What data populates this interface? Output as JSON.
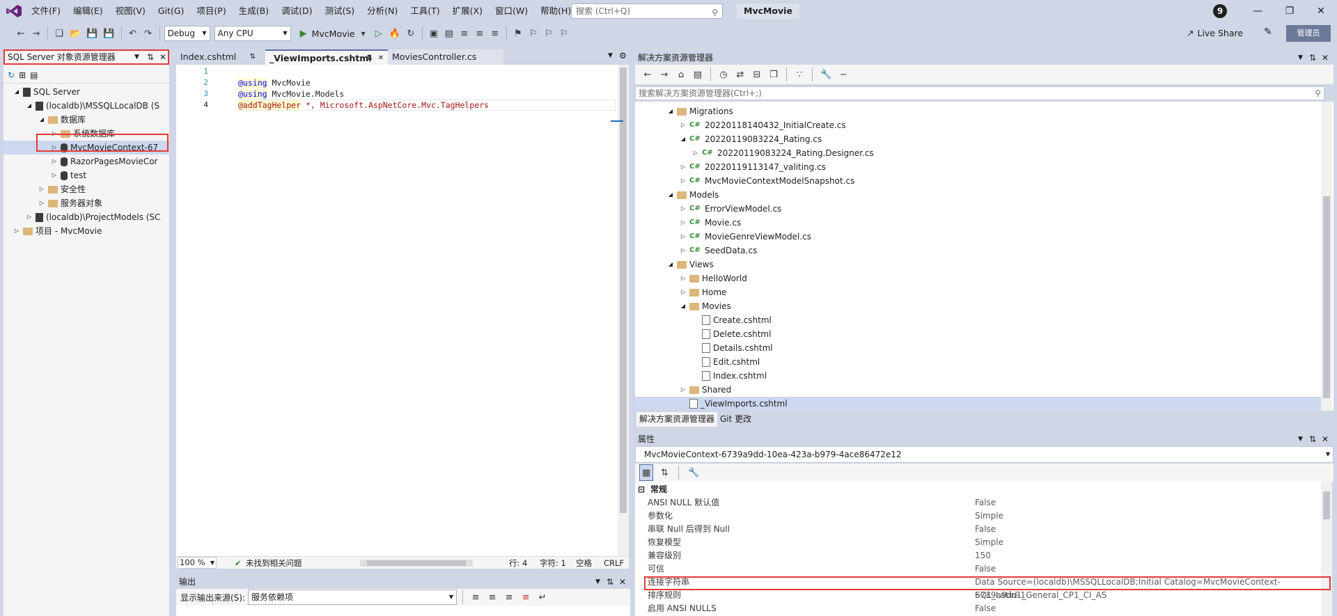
{
  "menubar": {
    "items": [
      "文件(F)",
      "编辑(E)",
      "视图(V)",
      "Git(G)",
      "项目(P)",
      "生成(B)",
      "调试(D)",
      "测试(S)",
      "分析(N)",
      "工具(T)",
      "扩展(X)",
      "窗口(W)",
      "帮助(H)"
    ],
    "search_placeholder": "搜索 (Ctrl+Q)",
    "app_title": "MvcMovie",
    "notification_count": "9"
  },
  "toolbar": {
    "config": "Debug",
    "platform": "Any CPU",
    "run_target": "MvcMovie",
    "live_share": "Live Share",
    "admin": "管理员"
  },
  "sql_explorer": {
    "title": "SQL Server 对象资源管理器",
    "nodes": [
      {
        "label": "SQL Server",
        "level": 1,
        "icon": "server-icon",
        "expand": "open"
      },
      {
        "label": "(localdb)\\MSSQLLocalDB (S",
        "level": 2,
        "icon": "server-icon",
        "expand": "open"
      },
      {
        "label": "数据库",
        "level": 3,
        "icon": "folder-icon",
        "expand": "open"
      },
      {
        "label": "系统数据库",
        "level": 4,
        "icon": "folder-icon",
        "expand": "closed"
      },
      {
        "label": "MvcMovieContext-67",
        "level": 4,
        "icon": "database-icon",
        "expand": "closed",
        "selected": true
      },
      {
        "label": "RazorPagesMovieCor",
        "level": 4,
        "icon": "database-icon",
        "expand": "closed"
      },
      {
        "label": "test",
        "level": 4,
        "icon": "database-icon",
        "expand": "closed"
      },
      {
        "label": "安全性",
        "level": 3,
        "icon": "folder-icon",
        "expand": "closed"
      },
      {
        "label": "服务器对象",
        "level": 3,
        "icon": "folder-icon",
        "expand": "closed"
      },
      {
        "label": "(localdb)\\ProjectModels (SC",
        "level": 2,
        "icon": "server-icon",
        "expand": "closed"
      },
      {
        "label": "项目 - MvcMovie",
        "level": 1,
        "icon": "folder-icon",
        "expand": "closed"
      }
    ]
  },
  "editor": {
    "tabs": [
      "Index.cshtml",
      "_ViewImports.cshtml",
      "MoviesController.cs"
    ],
    "active_tab": 1,
    "line_numbers": [
      "1",
      "2",
      "3",
      "4"
    ],
    "lines": [
      {
        "kw": "@using",
        "rest": " MvcMovie",
        "dir": false
      },
      {
        "kw": "@using",
        "rest": " MvcMovie.Models",
        "dir": false
      },
      {
        "kw": "@addTagHelper",
        "rest": " *, Microsoft.AspNetCore.Mvc.TagHelpers",
        "dir": true
      },
      {
        "kw": "",
        "rest": "",
        "dir": false
      }
    ],
    "status": {
      "zoom": "100 %",
      "issues": "未找到相关问题",
      "line": "行: 4",
      "char": "字符: 1",
      "space": "空格",
      "eol": "CRLF"
    }
  },
  "output": {
    "title": "输出",
    "source_label": "显示输出来源(S):",
    "source_value": "服务依赖项"
  },
  "solution_explorer": {
    "title": "解决方案资源管理器",
    "search_placeholder": "搜索解决方案资源管理器(Ctrl+;)",
    "nodes": [
      {
        "label": "Migrations",
        "level": 1,
        "icon": "folder-icon",
        "expand": "open"
      },
      {
        "label": "20220118140432_InitialCreate.cs",
        "level": 2,
        "icon": "csharp-icon",
        "expand": "closed"
      },
      {
        "label": "20220119083224_Rating.cs",
        "level": 2,
        "icon": "csharp-icon",
        "expand": "open"
      },
      {
        "label": "20220119083224_Rating.Designer.cs",
        "level": 3,
        "icon": "csharp-icon",
        "expand": "closed"
      },
      {
        "label": "20220119113147_valiting.cs",
        "level": 2,
        "icon": "csharp-icon",
        "expand": "closed"
      },
      {
        "label": "MvcMovieContextModelSnapshot.cs",
        "level": 2,
        "icon": "csharp-icon",
        "expand": "closed"
      },
      {
        "label": "Models",
        "level": 1,
        "icon": "folder-icon",
        "expand": "open"
      },
      {
        "label": "ErrorViewModel.cs",
        "level": 2,
        "icon": "csharp-icon",
        "expand": "closed"
      },
      {
        "label": "Movie.cs",
        "level": 2,
        "icon": "csharp-icon",
        "expand": "closed"
      },
      {
        "label": "MovieGenreViewModel.cs",
        "level": 2,
        "icon": "csharp-icon",
        "expand": "closed"
      },
      {
        "label": "SeedData.cs",
        "level": 2,
        "icon": "csharp-icon",
        "expand": "closed"
      },
      {
        "label": "Views",
        "level": 1,
        "icon": "folder-icon",
        "expand": "open"
      },
      {
        "label": "HelloWorld",
        "level": 2,
        "icon": "folder-icon",
        "expand": "closed"
      },
      {
        "label": "Home",
        "level": 2,
        "icon": "folder-icon",
        "expand": "closed"
      },
      {
        "label": "Movies",
        "level": 2,
        "icon": "folder-icon",
        "expand": "open"
      },
      {
        "label": "Create.cshtml",
        "level": 3,
        "icon": "file-icon",
        "expand": "none"
      },
      {
        "label": "Delete.cshtml",
        "level": 3,
        "icon": "file-icon",
        "expand": "none"
      },
      {
        "label": "Details.cshtml",
        "level": 3,
        "icon": "file-icon",
        "expand": "none"
      },
      {
        "label": "Edit.cshtml",
        "level": 3,
        "icon": "file-icon",
        "expand": "none"
      },
      {
        "label": "Index.cshtml",
        "level": 3,
        "icon": "file-icon",
        "expand": "none"
      },
      {
        "label": "Shared",
        "level": 2,
        "icon": "folder-icon",
        "expand": "closed"
      },
      {
        "label": "_ViewImports.cshtml",
        "level": 2,
        "icon": "file-icon",
        "expand": "none",
        "selected": true
      }
    ],
    "bottom_tabs": [
      "解决方案资源管理器",
      "Git 更改"
    ]
  },
  "properties": {
    "title": "属性",
    "object": "MvcMovieContext-6739a9dd-10ea-423a-b979-4ace86472e12",
    "category": "常规",
    "rows": [
      {
        "name": "ANSI NULL 默认值",
        "value": "False"
      },
      {
        "name": "参数化",
        "value": "Simple"
      },
      {
        "name": "串联 Null 后得到 Null",
        "value": "False"
      },
      {
        "name": "恢复模型",
        "value": "Simple"
      },
      {
        "name": "兼容级别",
        "value": "150"
      },
      {
        "name": "可信",
        "value": "False"
      },
      {
        "name": "连接字符串",
        "value": "Data Source=(localdb)\\MSSQLLocalDB;Initial Catalog=MvcMovieContext-6739a9dd-1"
      },
      {
        "name": "排序规则",
        "value": "SQL_Latin1_General_CP1_CI_AS"
      },
      {
        "name": "启用 ANSI NULLS",
        "value": "False"
      }
    ]
  },
  "colors": {
    "accent": "#5c6fa8",
    "highlight": "#e53935",
    "chrome": "#cfd6e5"
  }
}
